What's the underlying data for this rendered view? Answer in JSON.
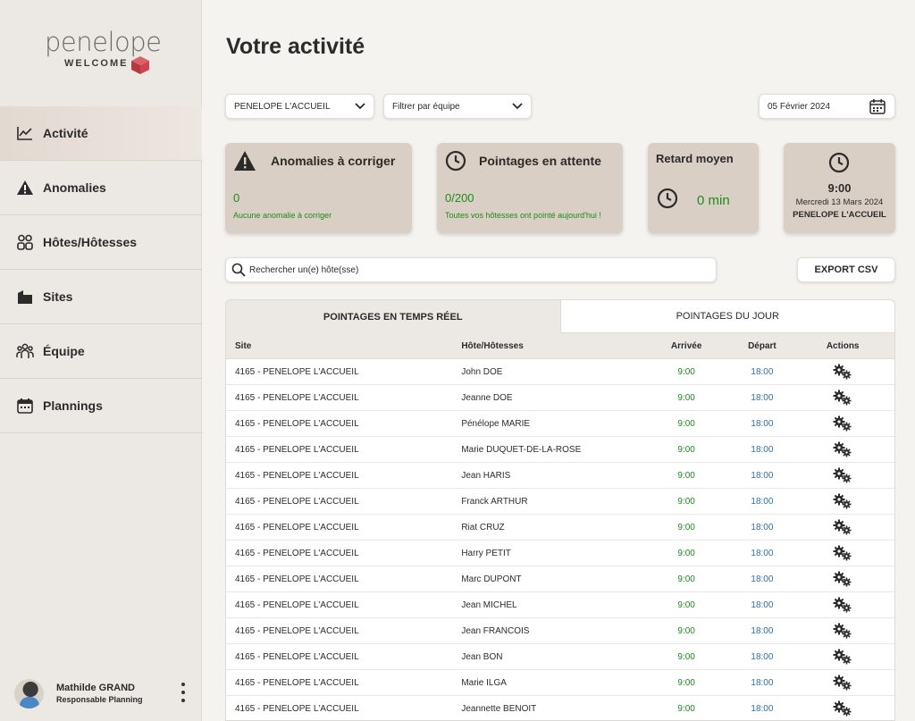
{
  "logo": {
    "word": "penelope",
    "sub": "WELCOME",
    "accent": "#c9474e"
  },
  "nav": [
    {
      "label": "Activité",
      "icon": "chart-icon",
      "active": true
    },
    {
      "label": "Anomalies",
      "icon": "warning-icon",
      "active": false
    },
    {
      "label": "Hôtes/Hôtesses",
      "icon": "users-icon",
      "active": false
    },
    {
      "label": "Sites",
      "icon": "building-icon",
      "active": false
    },
    {
      "label": "Équipe",
      "icon": "team-icon",
      "active": false
    },
    {
      "label": "Plannings",
      "icon": "calendar-icon",
      "active": false
    }
  ],
  "user": {
    "name": "Mathilde GRAND",
    "role": "Responsable Planning"
  },
  "page_title": "Votre activité",
  "filters": {
    "site": "PENELOPE L'ACCUEIL",
    "team": "Filtrer par équipe",
    "date": "05 Février 2024"
  },
  "cards": {
    "anomalies": {
      "title": "Anomalies à corriger",
      "value": "0",
      "note": "Aucune anomalie à corriger"
    },
    "pointages": {
      "title": "Pointages en attente",
      "value": "0/200",
      "note": "Toutes vos hôtesses ont pointé aujourd'hui !"
    },
    "retard": {
      "title": "Retard moyen",
      "value": "0 min"
    },
    "time": {
      "time": "9:00",
      "date": "Mercredi 13 Mars 2024",
      "site": "PENELOPE L'ACCUEIL"
    }
  },
  "search": {
    "placeholder": "Rechercher un(e) hôte(sse)"
  },
  "export_label": "EXPORT CSV",
  "tabs": [
    "POINTAGES EN TEMPS RÉEL",
    "POINTAGES DU JOUR"
  ],
  "table": {
    "headers": {
      "site": "Site",
      "name": "Hôte/Hôtesses",
      "arrival": "Arrivée",
      "departure": "Départ",
      "actions": "Actions"
    },
    "rows": [
      {
        "site": "4165 - PENELOPE L'ACCUEIL",
        "name": "John DOE",
        "arrival": "9:00",
        "departure": "18:00"
      },
      {
        "site": "4165 - PENELOPE L'ACCUEIL",
        "name": "Jeanne DOE",
        "arrival": "9:00",
        "departure": "18:00"
      },
      {
        "site": "4165 - PENELOPE L'ACCUEIL",
        "name": "Pénélope MARIE",
        "arrival": "9:00",
        "departure": "18:00"
      },
      {
        "site": "4165 - PENELOPE L'ACCUEIL",
        "name": "Marie DUQUET-DE-LA-ROSE",
        "arrival": "9:00",
        "departure": "18:00"
      },
      {
        "site": "4165 - PENELOPE L'ACCUEIL",
        "name": "Jean HARIS",
        "arrival": "9:00",
        "departure": "18:00"
      },
      {
        "site": "4165 - PENELOPE L'ACCUEIL",
        "name": "Franck ARTHUR",
        "arrival": "9:00",
        "departure": "18:00"
      },
      {
        "site": "4165 - PENELOPE L'ACCUEIL",
        "name": "Riat CRUZ",
        "arrival": "9:00",
        "departure": "18:00"
      },
      {
        "site": "4165 - PENELOPE L'ACCUEIL",
        "name": "Harry PETIT",
        "arrival": "9:00",
        "departure": "18:00"
      },
      {
        "site": "4165 - PENELOPE L'ACCUEIL",
        "name": "Marc DUPONT",
        "arrival": "9:00",
        "departure": "18:00"
      },
      {
        "site": "4165 - PENELOPE L'ACCUEIL",
        "name": "Jean MICHEL",
        "arrival": "9:00",
        "departure": "18:00"
      },
      {
        "site": "4165 - PENELOPE L'ACCUEIL",
        "name": "Jean FRANCOIS",
        "arrival": "9:00",
        "departure": "18:00"
      },
      {
        "site": "4165 - PENELOPE L'ACCUEIL",
        "name": "Jean BON",
        "arrival": "9:00",
        "departure": "18:00"
      },
      {
        "site": "4165 - PENELOPE L'ACCUEIL",
        "name": "Marie ILGA",
        "arrival": "9:00",
        "departure": "18:00"
      },
      {
        "site": "4165 - PENELOPE L'ACCUEIL",
        "name": "Jeannette BENOIT",
        "arrival": "9:00",
        "departure": "18:00"
      }
    ]
  },
  "colors": {
    "success": "#1e8a1e",
    "departure": "#2e6fa3",
    "card": "#d9cfc4",
    "sidebar": "#ece9e4"
  }
}
